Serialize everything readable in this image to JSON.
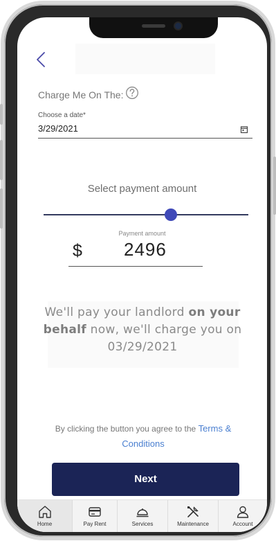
{
  "form": {
    "charge_label": "Charge Me On The:",
    "date_label": "Choose a date*",
    "date_value": "3/29/2021"
  },
  "payment": {
    "select_label": "Select payment amount",
    "amount_label": "Payment amount",
    "currency": "$",
    "amount": "2496",
    "slider_fraction": 0.62
  },
  "message": {
    "part1": "We'll pay your landlord ",
    "bold": "on your behalf",
    "part2": " now, we'll charge you on",
    "date": "03/29/2021"
  },
  "agreement": {
    "text": "By clicking the button you agree to the",
    "link": "Terms & Conditions"
  },
  "actions": {
    "next_label": "Next"
  },
  "tabs": [
    {
      "label": "Home",
      "icon": "home-icon",
      "active": true
    },
    {
      "label": "Pay Rent",
      "icon": "credit-card-icon",
      "active": false
    },
    {
      "label": "Services",
      "icon": "service-bell-icon",
      "active": false
    },
    {
      "label": "Maintenance",
      "icon": "tools-icon",
      "active": false
    },
    {
      "label": "Account",
      "icon": "user-icon",
      "active": false
    }
  ],
  "colors": {
    "primary": "#1b2456",
    "slider_thumb": "#3f49b8",
    "link": "#4a7fd0"
  }
}
